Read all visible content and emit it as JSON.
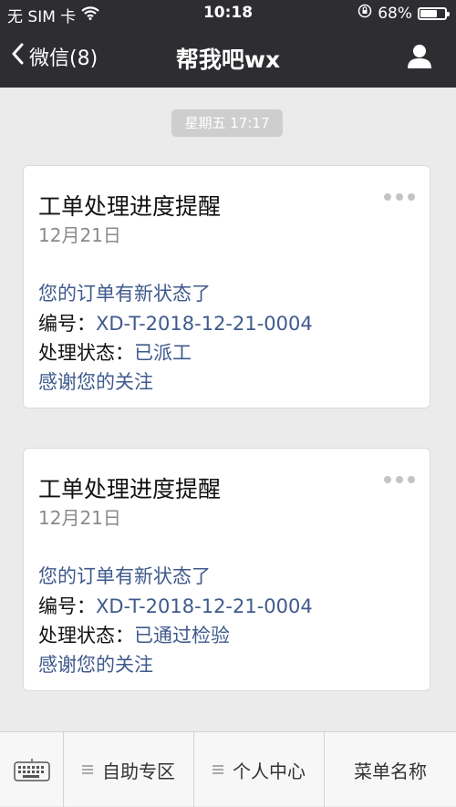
{
  "status_bar": {
    "carrier": "无 SIM 卡",
    "time": "10:18",
    "battery": "68%",
    "battery_level": 0.68
  },
  "nav": {
    "back_label": "微信(8)",
    "title": "帮我吧wx"
  },
  "chat": {
    "timestamp": "星期五 17:17",
    "messages": [
      {
        "title": "工单处理进度提醒",
        "date": "12月21日",
        "line1": "您的订单有新状态了",
        "number_label": "编号：",
        "number": "XD-T-2018-12-21-0004",
        "status_label": "处理状态：",
        "status": "已派工",
        "footer": "感谢您的关注"
      },
      {
        "title": "工单处理进度提醒",
        "date": "12月21日",
        "line1": "您的订单有新状态了",
        "number_label": "编号：",
        "number": "XD-T-2018-12-21-0004",
        "status_label": "处理状态：",
        "status": "已通过检验",
        "footer": "感谢您的关注"
      }
    ]
  },
  "tabbar": {
    "items": [
      {
        "label": "自助专区"
      },
      {
        "label": "个人中心"
      },
      {
        "label": "菜单名称"
      }
    ]
  }
}
